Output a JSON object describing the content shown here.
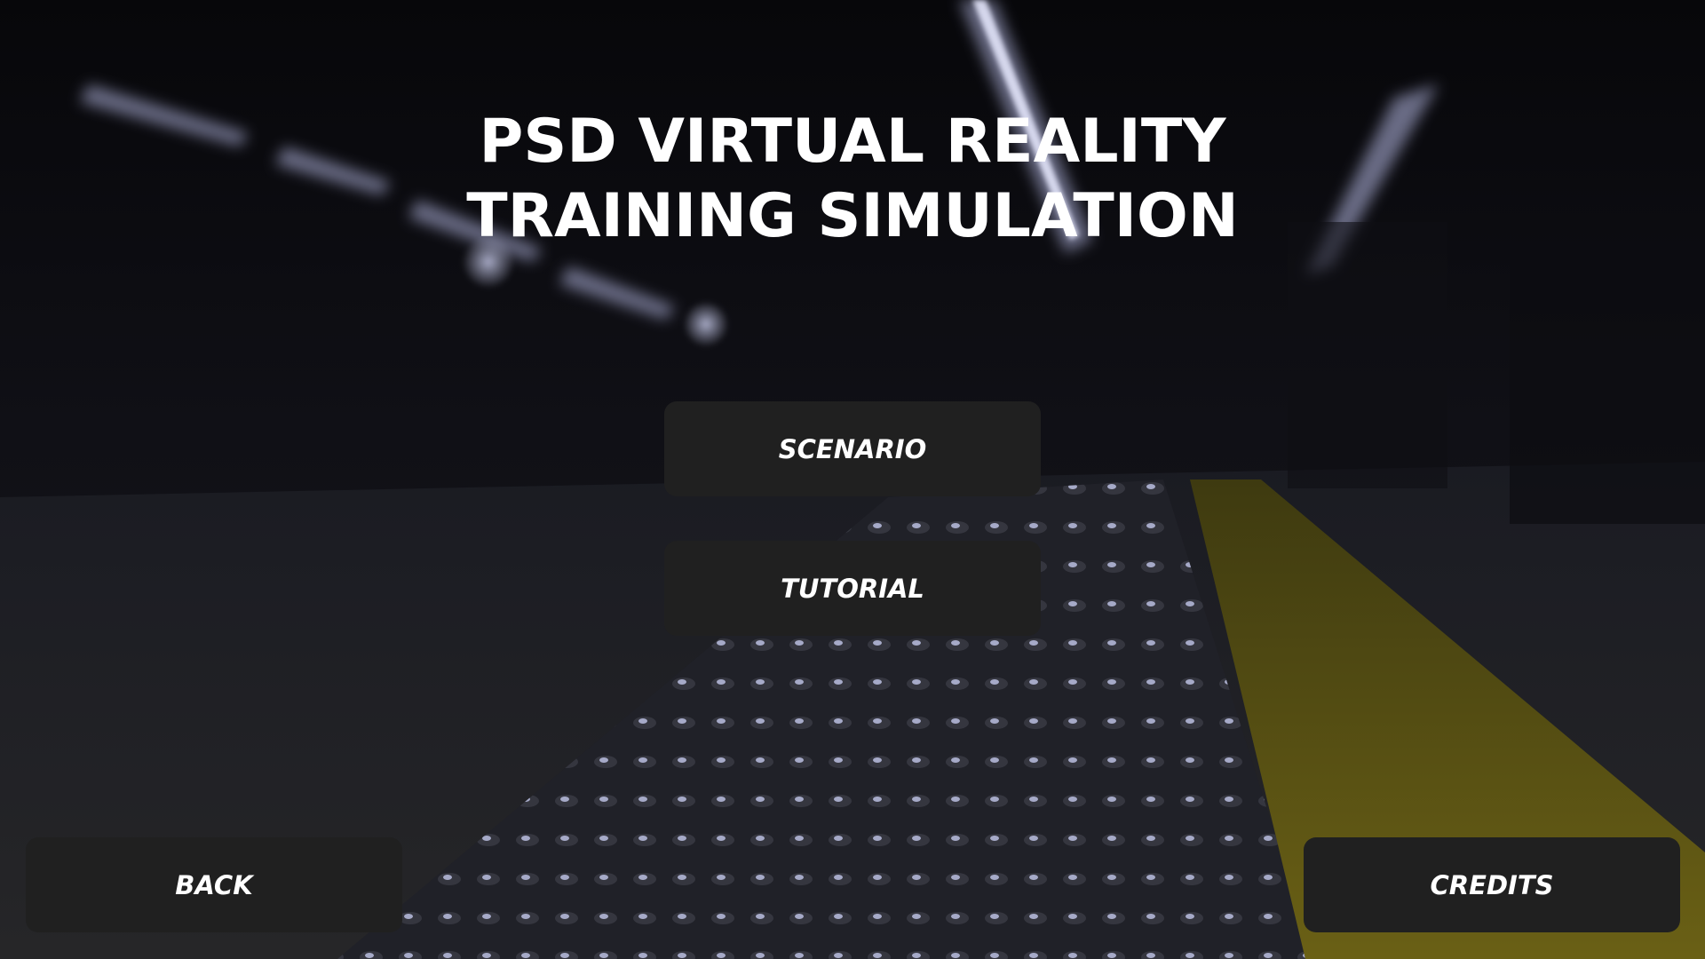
{
  "title": {
    "line1": "PSD VIRTUAL REALITY",
    "line2": "TRAINING SIMULATION"
  },
  "menu": {
    "scenario_label": "SCENARIO",
    "tutorial_label": "TUTORIAL"
  },
  "footer": {
    "back_label": "BACK",
    "credits_label": "CREDITS"
  },
  "colors": {
    "button_bg": "#202020",
    "text": "#ffffff",
    "tactile_strip": "#b8a51a"
  }
}
